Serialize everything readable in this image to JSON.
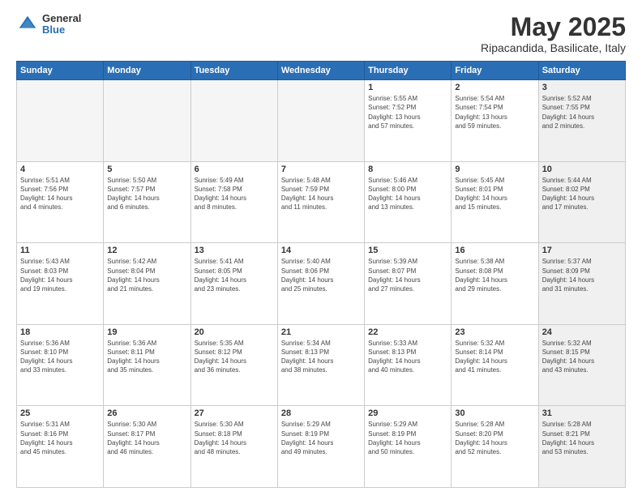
{
  "logo": {
    "general": "General",
    "blue": "Blue"
  },
  "header": {
    "month": "May 2025",
    "location": "Ripacandida, Basilicate, Italy"
  },
  "days": [
    "Sunday",
    "Monday",
    "Tuesday",
    "Wednesday",
    "Thursday",
    "Friday",
    "Saturday"
  ],
  "weeks": [
    [
      {
        "day": "",
        "info": "",
        "shade": true
      },
      {
        "day": "",
        "info": "",
        "shade": true
      },
      {
        "day": "",
        "info": "",
        "shade": true
      },
      {
        "day": "",
        "info": "",
        "shade": true
      },
      {
        "day": "1",
        "info": "Sunrise: 5:55 AM\nSunset: 7:52 PM\nDaylight: 13 hours\nand 57 minutes."
      },
      {
        "day": "2",
        "info": "Sunrise: 5:54 AM\nSunset: 7:54 PM\nDaylight: 13 hours\nand 59 minutes."
      },
      {
        "day": "3",
        "info": "Sunrise: 5:52 AM\nSunset: 7:55 PM\nDaylight: 14 hours\nand 2 minutes.",
        "shade": true
      }
    ],
    [
      {
        "day": "4",
        "info": "Sunrise: 5:51 AM\nSunset: 7:56 PM\nDaylight: 14 hours\nand 4 minutes."
      },
      {
        "day": "5",
        "info": "Sunrise: 5:50 AM\nSunset: 7:57 PM\nDaylight: 14 hours\nand 6 minutes."
      },
      {
        "day": "6",
        "info": "Sunrise: 5:49 AM\nSunset: 7:58 PM\nDaylight: 14 hours\nand 8 minutes."
      },
      {
        "day": "7",
        "info": "Sunrise: 5:48 AM\nSunset: 7:59 PM\nDaylight: 14 hours\nand 11 minutes."
      },
      {
        "day": "8",
        "info": "Sunrise: 5:46 AM\nSunset: 8:00 PM\nDaylight: 14 hours\nand 13 minutes."
      },
      {
        "day": "9",
        "info": "Sunrise: 5:45 AM\nSunset: 8:01 PM\nDaylight: 14 hours\nand 15 minutes."
      },
      {
        "day": "10",
        "info": "Sunrise: 5:44 AM\nSunset: 8:02 PM\nDaylight: 14 hours\nand 17 minutes.",
        "shade": true
      }
    ],
    [
      {
        "day": "11",
        "info": "Sunrise: 5:43 AM\nSunset: 8:03 PM\nDaylight: 14 hours\nand 19 minutes."
      },
      {
        "day": "12",
        "info": "Sunrise: 5:42 AM\nSunset: 8:04 PM\nDaylight: 14 hours\nand 21 minutes."
      },
      {
        "day": "13",
        "info": "Sunrise: 5:41 AM\nSunset: 8:05 PM\nDaylight: 14 hours\nand 23 minutes."
      },
      {
        "day": "14",
        "info": "Sunrise: 5:40 AM\nSunset: 8:06 PM\nDaylight: 14 hours\nand 25 minutes."
      },
      {
        "day": "15",
        "info": "Sunrise: 5:39 AM\nSunset: 8:07 PM\nDaylight: 14 hours\nand 27 minutes."
      },
      {
        "day": "16",
        "info": "Sunrise: 5:38 AM\nSunset: 8:08 PM\nDaylight: 14 hours\nand 29 minutes."
      },
      {
        "day": "17",
        "info": "Sunrise: 5:37 AM\nSunset: 8:09 PM\nDaylight: 14 hours\nand 31 minutes.",
        "shade": true
      }
    ],
    [
      {
        "day": "18",
        "info": "Sunrise: 5:36 AM\nSunset: 8:10 PM\nDaylight: 14 hours\nand 33 minutes."
      },
      {
        "day": "19",
        "info": "Sunrise: 5:36 AM\nSunset: 8:11 PM\nDaylight: 14 hours\nand 35 minutes."
      },
      {
        "day": "20",
        "info": "Sunrise: 5:35 AM\nSunset: 8:12 PM\nDaylight: 14 hours\nand 36 minutes."
      },
      {
        "day": "21",
        "info": "Sunrise: 5:34 AM\nSunset: 8:13 PM\nDaylight: 14 hours\nand 38 minutes."
      },
      {
        "day": "22",
        "info": "Sunrise: 5:33 AM\nSunset: 8:13 PM\nDaylight: 14 hours\nand 40 minutes."
      },
      {
        "day": "23",
        "info": "Sunrise: 5:32 AM\nSunset: 8:14 PM\nDaylight: 14 hours\nand 41 minutes."
      },
      {
        "day": "24",
        "info": "Sunrise: 5:32 AM\nSunset: 8:15 PM\nDaylight: 14 hours\nand 43 minutes.",
        "shade": true
      }
    ],
    [
      {
        "day": "25",
        "info": "Sunrise: 5:31 AM\nSunset: 8:16 PM\nDaylight: 14 hours\nand 45 minutes."
      },
      {
        "day": "26",
        "info": "Sunrise: 5:30 AM\nSunset: 8:17 PM\nDaylight: 14 hours\nand 46 minutes."
      },
      {
        "day": "27",
        "info": "Sunrise: 5:30 AM\nSunset: 8:18 PM\nDaylight: 14 hours\nand 48 minutes."
      },
      {
        "day": "28",
        "info": "Sunrise: 5:29 AM\nSunset: 8:19 PM\nDaylight: 14 hours\nand 49 minutes."
      },
      {
        "day": "29",
        "info": "Sunrise: 5:29 AM\nSunset: 8:19 PM\nDaylight: 14 hours\nand 50 minutes."
      },
      {
        "day": "30",
        "info": "Sunrise: 5:28 AM\nSunset: 8:20 PM\nDaylight: 14 hours\nand 52 minutes."
      },
      {
        "day": "31",
        "info": "Sunrise: 5:28 AM\nSunset: 8:21 PM\nDaylight: 14 hours\nand 53 minutes.",
        "shade": true
      }
    ]
  ]
}
